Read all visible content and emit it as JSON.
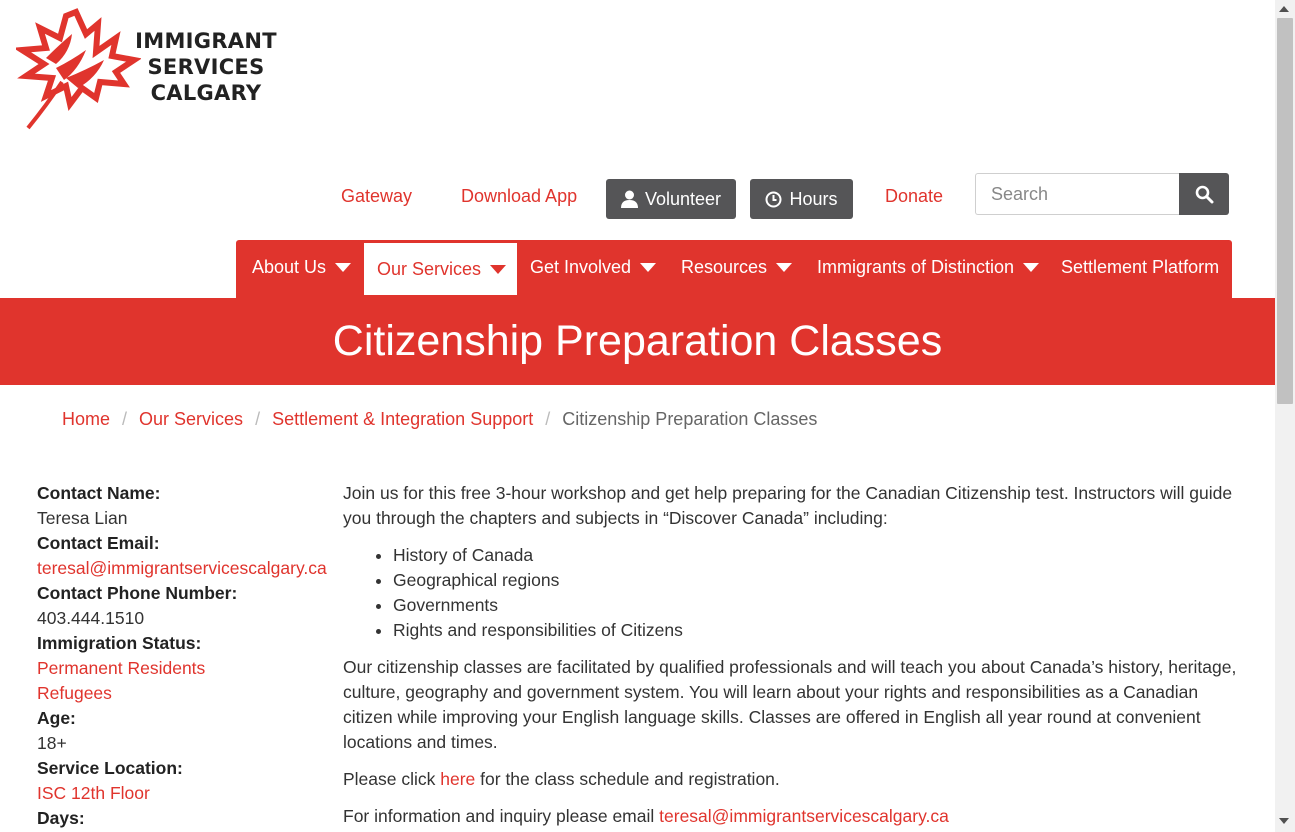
{
  "brand": {
    "logo_line1": "IMMIGRANT",
    "logo_line2": "SERVICES",
    "logo_line3": "CALGARY",
    "accent": "#e0342d",
    "dark_button": "#555557"
  },
  "utility": {
    "gateway": "Gateway",
    "download_app": "Download App",
    "volunteer": "Volunteer",
    "hours": "Hours",
    "donate": "Donate",
    "search_placeholder": "Search"
  },
  "nav": {
    "items": [
      {
        "label": "About Us"
      },
      {
        "label": "Our Services"
      },
      {
        "label": "Get Involved"
      },
      {
        "label": "Resources"
      },
      {
        "label": "Immigrants of Distinction"
      },
      {
        "label": "Settlement Platform"
      }
    ],
    "active": "Our Services"
  },
  "page": {
    "title": "Citizenship Preparation Classes"
  },
  "breadcrumb": {
    "items": [
      "Home",
      "Our Services",
      "Settlement & Integration Support"
    ],
    "current": "Citizenship Preparation Classes",
    "separator": "/"
  },
  "sidebar": {
    "contact_name_label": "Contact Name:",
    "contact_name": "Teresa Lian",
    "contact_email_label": "Contact Email:",
    "contact_email": "teresal@immigrantservicescalgary.ca",
    "contact_phone_label": "Contact Phone Number:",
    "contact_phone": "403.444.1510",
    "immigration_status_label": "Immigration Status:",
    "immigration_status": [
      "Permanent Residents",
      "Refugees"
    ],
    "age_label": "Age:",
    "age": "18+",
    "service_location_label": "Service Location:",
    "service_location": "ISC 12th Floor",
    "days_label": "Days:"
  },
  "content": {
    "intro": "Join us for this free 3-hour workshop and get help preparing for the Canadian Citizenship test. Instructors will guide you through the chapters and subjects in “Discover Canada” including:",
    "topics": [
      "History of Canada",
      "Geographical regions",
      "Governments",
      "Rights and responsibilities of Citizens"
    ],
    "description": "Our citizenship classes are facilitated by qualified professionals and will teach you about Canada’s history, heritage, culture, geography and government system.  You will learn about your rights and responsibilities as a Canadian citizen while improving your English language skills. Classes are offered in English all year round at convenient locations and times.",
    "click_prefix": "Please click ",
    "click_link": "here",
    "click_suffix": " for the class schedule and registration.",
    "info_prefix": "For information and inquiry please email ",
    "info_email": "teresal@immigrantservicescalgary.ca"
  }
}
